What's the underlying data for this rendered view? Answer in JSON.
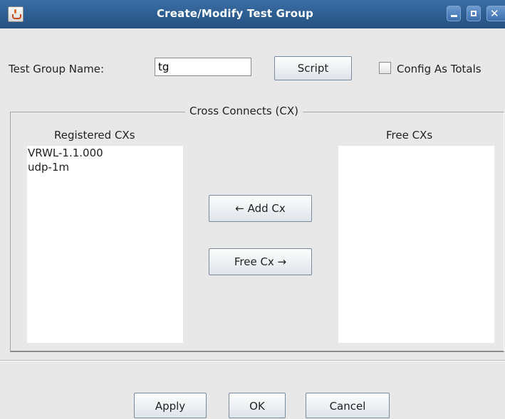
{
  "window": {
    "title": "Create/Modify Test Group",
    "controls": [
      "minimize-icon",
      "maximize-icon",
      "close-icon"
    ]
  },
  "form": {
    "name_label": "Test Group Name:",
    "name_value": "tg",
    "script_button": "Script",
    "config_totals_label": "Config As Totals",
    "config_totals_checked": false
  },
  "cross_connects": {
    "legend": "Cross Connects (CX)",
    "registered_header": "Registered CXs",
    "free_header": "Free CXs",
    "registered_items": [
      "VRWL-1.1.000",
      "udp-1m"
    ],
    "free_items": [],
    "add_button": "← Add Cx",
    "free_button": "Free Cx →"
  },
  "footer": {
    "apply": "Apply",
    "ok": "OK",
    "cancel": "Cancel"
  }
}
